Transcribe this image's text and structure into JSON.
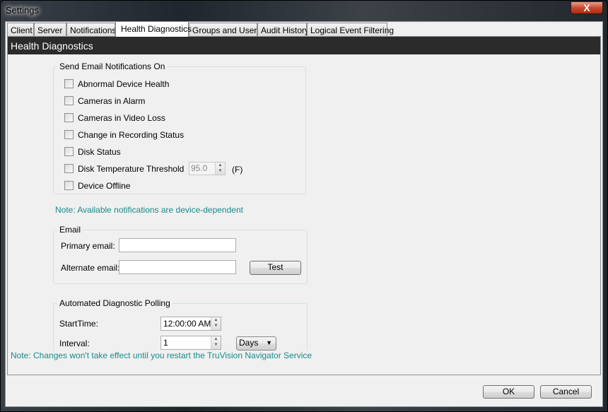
{
  "window": {
    "title": "Settings",
    "close_glyph": "X"
  },
  "tabs": [
    {
      "label": "Client"
    },
    {
      "label": "Server"
    },
    {
      "label": "Notifications"
    },
    {
      "label": "Health Diagnostics",
      "active": true
    },
    {
      "label": "Groups and Users"
    },
    {
      "label": "Audit History"
    },
    {
      "label": "Logical Event Filtering"
    }
  ],
  "header": {
    "title": "Health Diagnostics"
  },
  "notifications": {
    "legend": "Send Email Notifications On",
    "items": [
      {
        "label": "Abnormal Device Health",
        "checked": false
      },
      {
        "label": "Cameras in Alarm",
        "checked": false
      },
      {
        "label": "Cameras in Video Loss",
        "checked": false
      },
      {
        "label": "Change in Recording Status",
        "checked": false
      },
      {
        "label": "Disk Status",
        "checked": false
      },
      {
        "label": "Disk Temperature Threshold",
        "checked": false
      },
      {
        "label": "Device Offline",
        "checked": false
      }
    ],
    "temperature_value": "95.0",
    "temperature_unit": "(F)"
  },
  "note_devices": "Note: Available notifications are device-dependent",
  "email": {
    "legend": "Email",
    "primary_label": "Primary email:",
    "primary_value": "",
    "alternate_label": "Alternate email:",
    "alternate_value": "",
    "test_label": "Test"
  },
  "polling": {
    "legend": "Automated Diagnostic Polling",
    "start_label": "StartTime:",
    "start_value": "12:00:00 AM",
    "interval_label": "Interval:",
    "interval_value": "1",
    "unit_value": "Days"
  },
  "note_restart": "Note: Changes won't take effect until you restart the TruVision Navigator Service",
  "footer": {
    "ok_label": "OK",
    "cancel_label": "Cancel"
  },
  "colors": {
    "note": "#1a8a8a",
    "header_bg": "#2b2b2b"
  }
}
